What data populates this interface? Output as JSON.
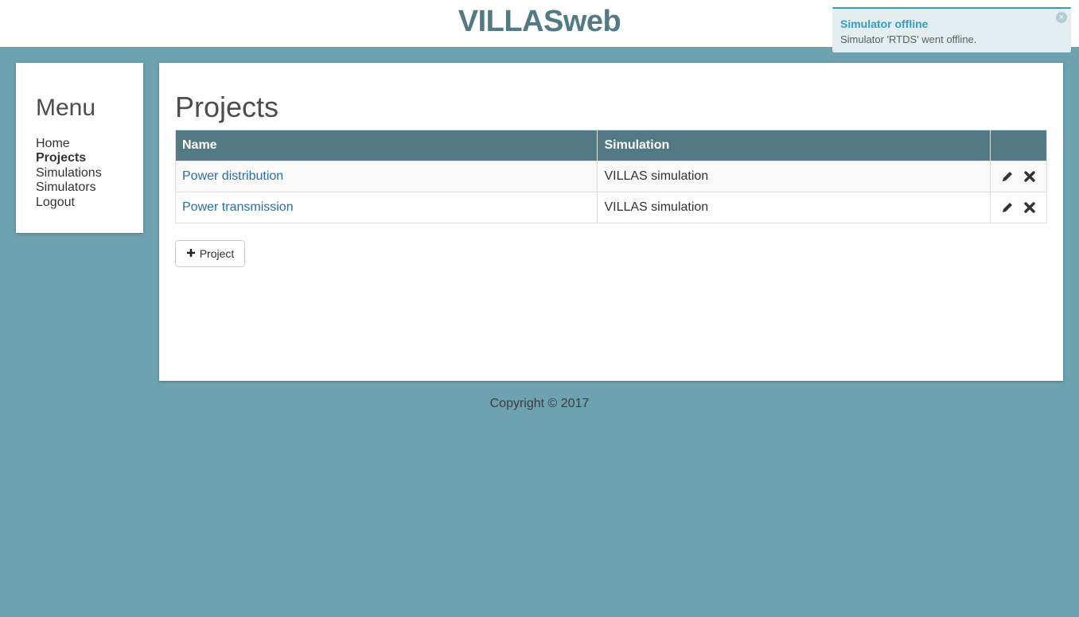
{
  "header": {
    "title": "VILLASweb"
  },
  "notification": {
    "title": "Simulator offline",
    "message": "Simulator 'RTDS' went offline.",
    "close_icon": "close-circle-icon"
  },
  "menu": {
    "title": "Menu",
    "items": [
      {
        "label": "Home",
        "active": false
      },
      {
        "label": "Projects",
        "active": true
      },
      {
        "label": "Simulations",
        "active": false
      },
      {
        "label": "Simulators",
        "active": false
      },
      {
        "label": "Logout",
        "active": false
      }
    ]
  },
  "main": {
    "title": "Projects",
    "table": {
      "columns": [
        "Name",
        "Simulation",
        ""
      ],
      "rows": [
        {
          "name": "Power distribution",
          "simulation": "VILLAS simulation"
        },
        {
          "name": "Power transmission",
          "simulation": "VILLAS simulation"
        }
      ],
      "row_actions": [
        "pencil-icon",
        "times-icon"
      ]
    },
    "add_button": {
      "icon": "plus-icon",
      "label": "Project"
    }
  },
  "footer": {
    "text": "Copyright © 2017"
  },
  "colors": {
    "background": "#6ea2b0",
    "table_header": "#527984",
    "brand_title": "#527984",
    "link": "#2a6fb0",
    "notification_accent": "#369cc7"
  }
}
